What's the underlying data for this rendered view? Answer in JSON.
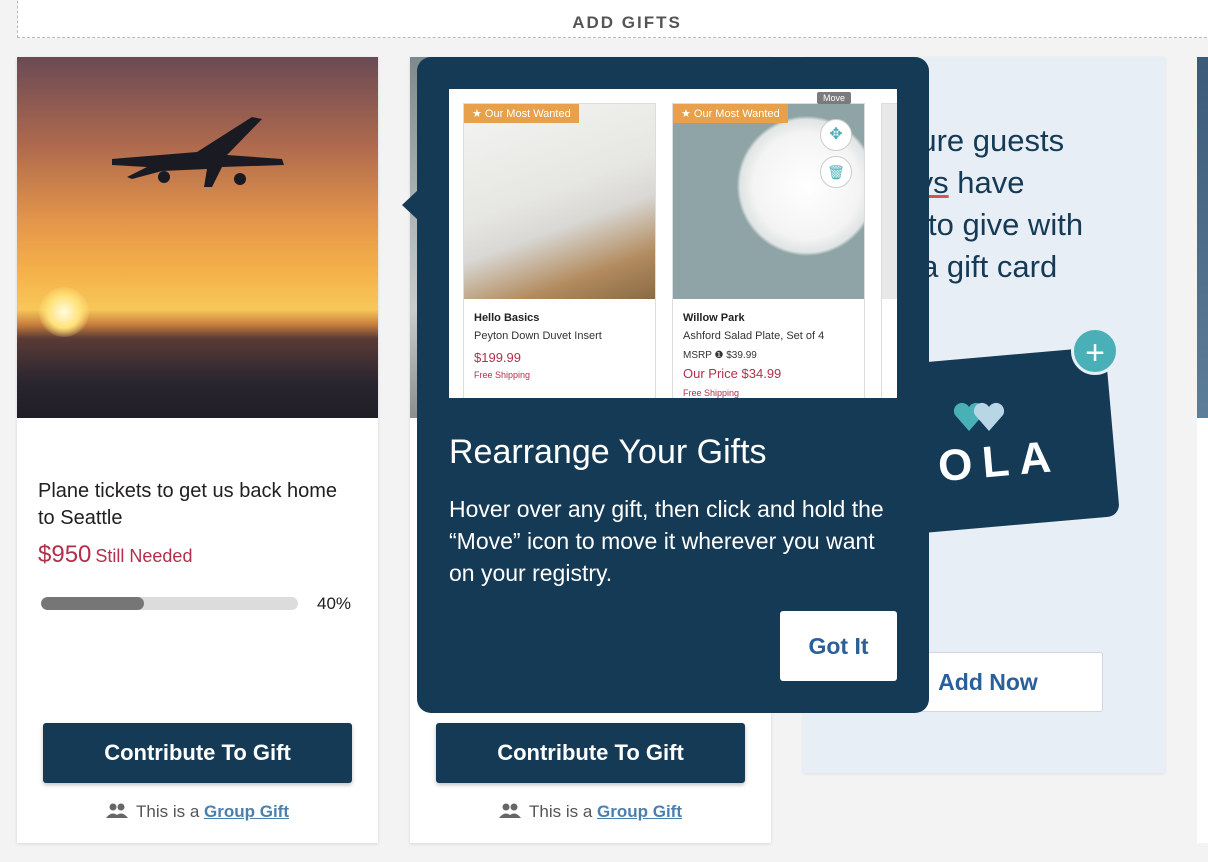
{
  "header": {
    "add_gifts": "ADD GIFTS"
  },
  "cards": [
    {
      "title": "Plane tickets to get us back home to Seattle",
      "amount": "$950",
      "amount_label": "Still Needed",
      "progress_pct": 40,
      "progress_text": "40%",
      "button": "Contribute To Gift",
      "group_prefix": "This is a",
      "group_link": "Group Gift"
    },
    {
      "button": "Contribute To Gift",
      "group_prefix": "This is a",
      "group_link": "Group Gift"
    }
  ],
  "zola_promo": {
    "text_line1": "e sure guests",
    "text_line2a": "ways",
    "text_line2b": " have",
    "text_line3": "ing to give with",
    "text_line4": "Zola gift card",
    "card_word": "OLA",
    "add_button": "Add Now"
  },
  "tooltip": {
    "title": "Rearrange Your Gifts",
    "body": "Hover over any gift, then click and hold the “Move” icon to move it wherever you want on your registry.",
    "button": "Got It",
    "preview": {
      "move_label": "Move",
      "items": [
        {
          "badge": "★ Our Most Wanted",
          "brand": "Hello Basics",
          "name": "Peyton Down Duvet Insert",
          "price": "$199.99",
          "shipping": "Free Shipping"
        },
        {
          "badge": "★ Our Most Wanted",
          "brand": "Willow Park",
          "name": "Ashford Salad Plate, Set of 4",
          "msrp": "MSRP ❶  $39.99",
          "our_price": "Our Price $34.99",
          "shipping": "Free Shipping"
        }
      ]
    }
  },
  "colors": {
    "navy": "#153a56",
    "accent_red": "#b22f4b",
    "link_blue": "#4a7fae",
    "teal": "#4ab0b8"
  }
}
